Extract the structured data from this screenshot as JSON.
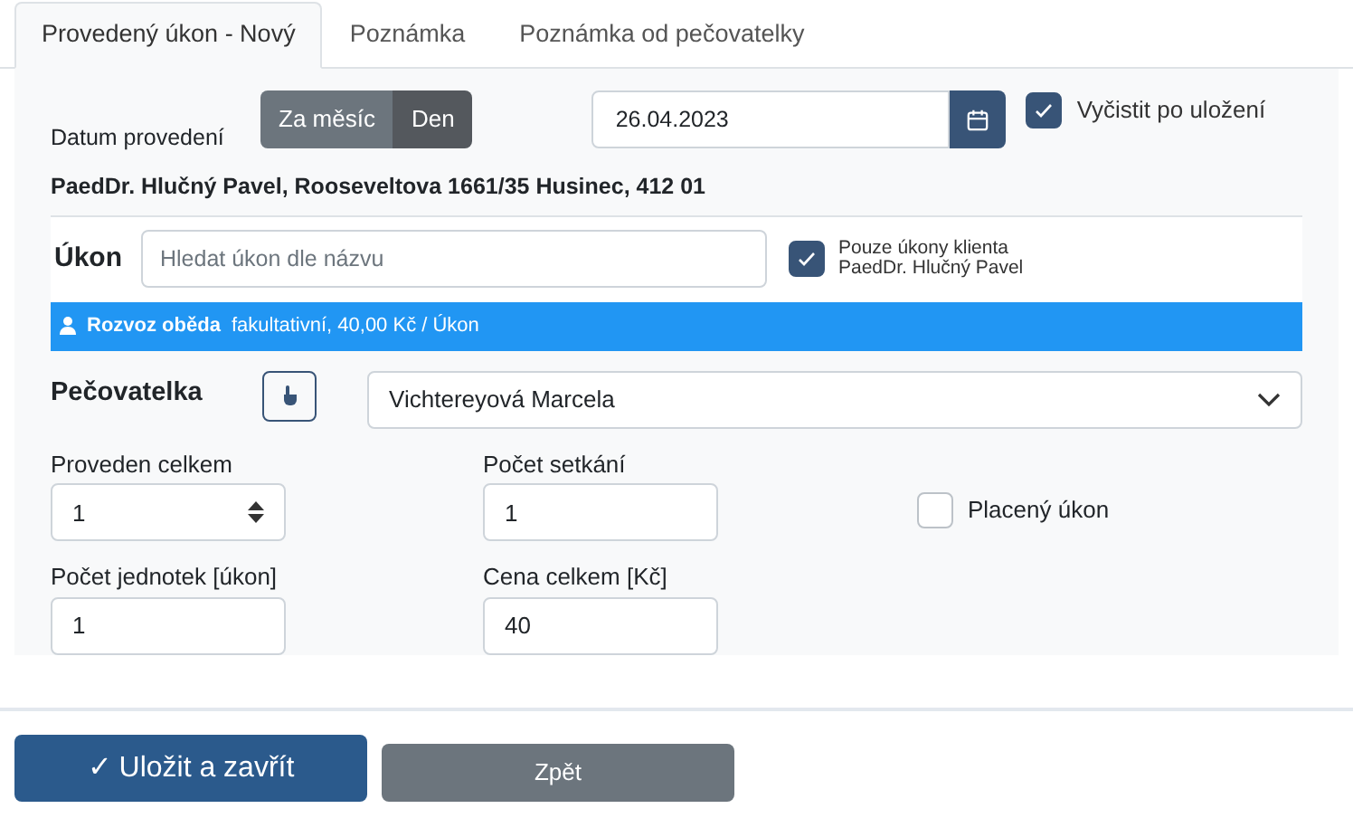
{
  "tabs": [
    {
      "label": "Provedený úkon - Nový",
      "selected": true
    },
    {
      "label": "Poznámka",
      "selected": false
    },
    {
      "label": "Poznámka od pečovatelky",
      "selected": false
    }
  ],
  "date_row": {
    "label": "Datum provedení",
    "modes": [
      {
        "label": "Za měsíc",
        "selected": false
      },
      {
        "label": "Den",
        "selected": true
      }
    ],
    "date": "26.04.2023",
    "clear_after_save": {
      "label": "Vyčistit po uložení",
      "checked": true
    }
  },
  "client": "PaedDr. Hlučný Pavel, Rooseveltova 1661/35 Husinec, 412 01",
  "service": {
    "label": "Úkon",
    "placeholder": "Hledat úkon dle názvu",
    "only_client": {
      "label_lines": [
        "Pouze úkony klienta",
        "PaedDr. Hlučný Pavel"
      ],
      "checked": true
    }
  },
  "selected_service": {
    "name": "Rozvoz oběda",
    "detail": "fakultativní, 40,00 Kč / Úkon"
  },
  "caregiver": {
    "label": "Pečovatelka",
    "value": "Vichtereyová Marcela"
  },
  "fields": [
    {
      "kind": "spinner",
      "label": "Proveden celkem",
      "value": "1"
    },
    {
      "kind": "text",
      "label": "Počet setkání",
      "value": "1"
    },
    {
      "kind": "checkbox",
      "label": "Placený úkon",
      "checked": false
    },
    {
      "kind": "text",
      "label": "Počet jednotek [úkon]",
      "value": "1"
    },
    {
      "kind": "text",
      "label": "Cena celkem [Kč]",
      "value": "40"
    }
  ],
  "buttons": [
    {
      "kind": "primary",
      "label": "✓ Uložit a zavřít"
    },
    {
      "kind": "secondary",
      "label": "Zpět"
    }
  ]
}
